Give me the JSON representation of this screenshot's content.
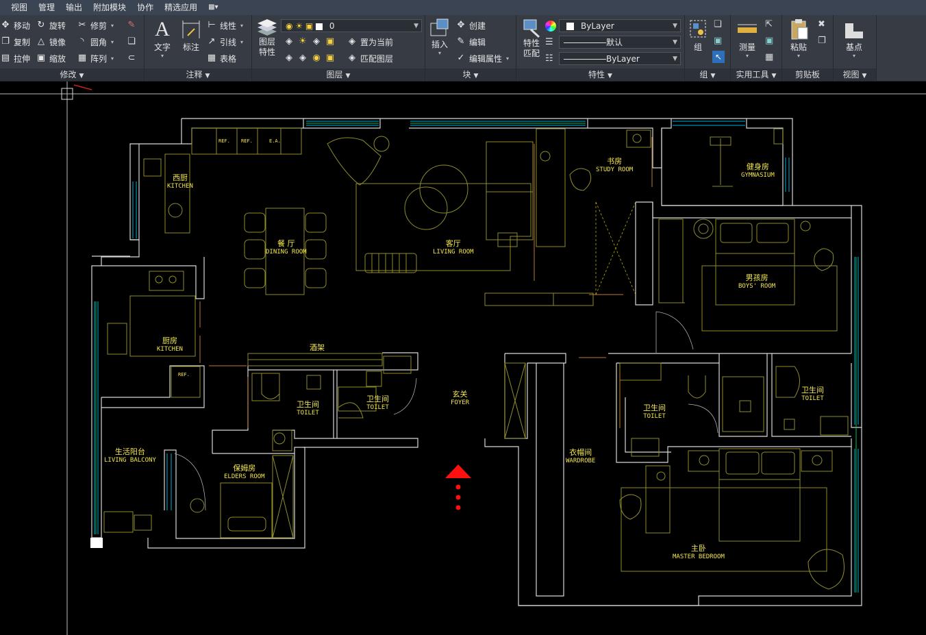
{
  "menu": [
    "视图",
    "管理",
    "输出",
    "附加模块",
    "协作",
    "精选应用"
  ],
  "ribbon": {
    "modify": {
      "title": "修改",
      "move": "移动",
      "rotate": "旋转",
      "trim": "修剪",
      "copy": "复制",
      "mirror": "镜像",
      "fillet": "圆角",
      "stretch": "拉伸",
      "scale": "缩放",
      "array": "阵列"
    },
    "annotation": {
      "title": "注释",
      "text": "文字",
      "dimension": "标注",
      "linear": "线性",
      "leader": "引线",
      "table": "表格"
    },
    "layers": {
      "title": "图层",
      "properties_line1": "图层",
      "properties_line2": "特性",
      "current_layer": "0",
      "set_current": "置为当前",
      "match_layer": "匹配图层"
    },
    "block": {
      "title": "块",
      "insert": "插入",
      "create": "创建",
      "edit": "编辑",
      "edit_attributes": "编辑属性"
    },
    "properties": {
      "title": "特性",
      "match_line1": "特性",
      "match_line2": "匹配",
      "color": "ByLayer",
      "lineweight": "默认",
      "linetype": "ByLayer"
    },
    "groups": {
      "title": "组",
      "group": "组"
    },
    "utilities": {
      "title": "实用工具",
      "measure": "测量"
    },
    "clipboard": {
      "title": "剪贴板",
      "paste": "粘贴"
    },
    "view": {
      "title": "视图",
      "base": "基点"
    }
  },
  "rooms": {
    "west_kitchen": {
      "cn": "西厨",
      "en": "KITCHEN"
    },
    "dining": {
      "cn": "餐  厅",
      "en": "DINING ROOM"
    },
    "living": {
      "cn": "客厅",
      "en": "LIVING ROOM"
    },
    "study": {
      "cn": "书房",
      "en": "STUDY ROOM"
    },
    "gym": {
      "cn": "健身房",
      "en": "GYMNASIUM"
    },
    "boys": {
      "cn": "男孩房",
      "en": "BOYS' ROOM"
    },
    "kitchen": {
      "cn": "厨房",
      "en": "KITCHEN"
    },
    "toilet1": {
      "cn": "卫生间",
      "en": "TOILET"
    },
    "toilet2": {
      "cn": "卫生间",
      "en": "TOILET"
    },
    "foyer": {
      "cn": "玄关",
      "en": "FOYER"
    },
    "toilet3": {
      "cn": "卫生间",
      "en": "TOILET"
    },
    "toilet4": {
      "cn": "卫生间",
      "en": "TOILET"
    },
    "balcony": {
      "cn": "生活阳台",
      "en": "LIVING BALCONY"
    },
    "elders": {
      "cn": "保姆房",
      "en": "ELDERS ROOM"
    },
    "wardrobe": {
      "cn": "衣帽间",
      "en": "WARDROBE"
    },
    "master": {
      "cn": "主卧",
      "en": "MASTER BEDROOM"
    },
    "wine_rack": "酒架"
  },
  "appliances": [
    "REF.",
    "REF.",
    "E.A.",
    "REF."
  ],
  "colors": {
    "wall": "#d8d8d8",
    "furniture": "#8f8d2a",
    "text": "#f3e84d",
    "window": "#00b0d8",
    "window2": "#00c060",
    "arrow": "#ff0000",
    "dim": "#c07a30"
  }
}
